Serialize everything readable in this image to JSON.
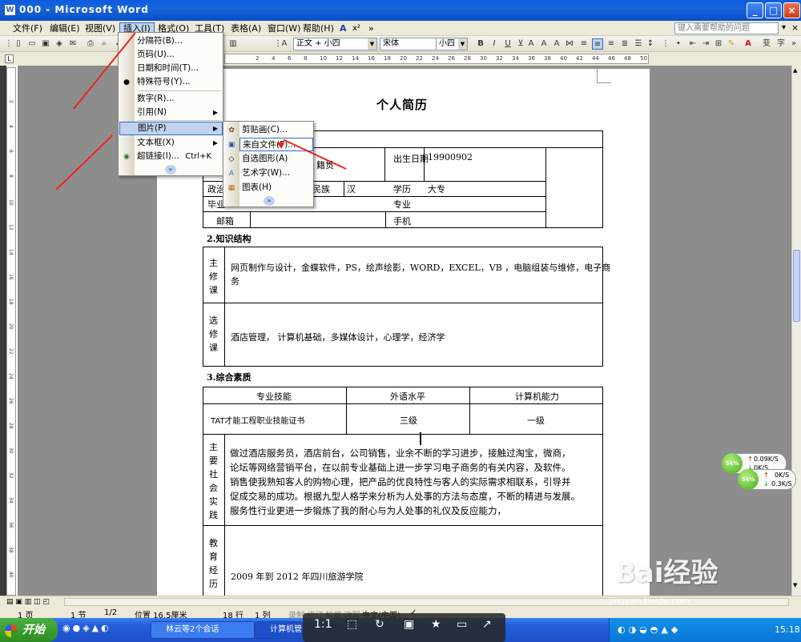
{
  "window": {
    "title": "000 - Microsoft Word"
  },
  "menubar": {
    "items": [
      "文件(F)",
      "编辑(E)",
      "视图(V)",
      "插入(I)",
      "格式(O)",
      "工具(T)",
      "表格(A)",
      "窗口(W)",
      "帮助(H)"
    ],
    "help_placeholder": "键入需要帮助的问题"
  },
  "toolbar": {
    "style": "正文 + 小四",
    "font": "宋体",
    "size": "小四"
  },
  "ruler": {
    "ticks": [
      "2",
      "4",
      "6",
      "8",
      "10",
      "12",
      "14",
      "16",
      "18",
      "20",
      "22",
      "24",
      "26",
      "28",
      "30",
      "32",
      "34",
      "36",
      "38",
      "40",
      "42",
      "44",
      "46",
      "48",
      "50"
    ],
    "vticks": [
      "2",
      "4",
      "6",
      "8",
      "10",
      "12",
      "14",
      "16",
      "18",
      "20",
      "22",
      "24",
      "26",
      "28",
      "30",
      "32",
      "34",
      "36",
      "38",
      "40"
    ]
  },
  "insert_menu": {
    "items": [
      {
        "label": "分隔符(B)...",
        "icon": "none"
      },
      {
        "label": "页码(U)...",
        "icon": "none"
      },
      {
        "label": "日期和时间(T)...",
        "icon": "none"
      },
      {
        "label": "特殊符号(Y)...",
        "icon": "bullet"
      },
      {
        "label": "数字(R)...",
        "icon": "none"
      },
      {
        "label": "引用(N)",
        "icon": "none",
        "submenu": true
      },
      {
        "label": "图片(P)",
        "icon": "none",
        "submenu": true,
        "highlighted": true
      },
      {
        "label": "文本框(X)",
        "icon": "none",
        "submenu": true
      },
      {
        "label": "超链接(I)...",
        "shortcut": "Ctrl+K",
        "icon": "globe-link"
      }
    ]
  },
  "picture_menu": {
    "items": [
      {
        "label": "剪贴画(C)...",
        "icon": "clipart"
      },
      {
        "label": "来自文件(F)...",
        "icon": "image-file"
      },
      {
        "label": "自选图形(A)",
        "icon": "autoshape"
      },
      {
        "label": "艺术字(W)...",
        "icon": "wordart"
      },
      {
        "label": "图表(H)",
        "icon": "chart"
      }
    ]
  },
  "document": {
    "title": "个人简历",
    "table1": {
      "visible": [
        "籍贯",
        "出生日期",
        "19900902",
        "政治",
        "民族",
        "汉",
        "学历",
        "大专",
        "毕业",
        "专业",
        "邮箱",
        "手机"
      ]
    },
    "section2": {
      "heading": "2.知识结构",
      "major_label": "主修课",
      "major_text_1": "网页制作与设计，金蝶软件，PS，绘声绘影，WORD，EXCEL，VB ，电脑组装与维修，电子商",
      "major_text_2": "务",
      "elective_label": "选修课",
      "elective_text": "酒店管理，  计算机基础，多媒体设计，心理学，经济学"
    },
    "section3": {
      "heading": "3.综合素质",
      "headers": [
        "专业技能",
        "外语水平",
        "计算机能力"
      ],
      "row": [
        "TAT才能工程职业技能证书",
        "三级",
        "一级"
      ],
      "practice_label": "主要社会实践",
      "practice_lines": [
        "    做过酒店服务员，酒店前台，公司销售，业余不断的学习进步，接触过淘宝，微商，",
        "论坛等网络营销平台，在以前专业基础上进一步学习电子商务的有关内容，及软件。",
        "销售使我熟知客人的购物心理，把产品的优良特性与客人的实际需求相联系，引导并",
        "促成交易的成功。根据九型人格学来分析为人处事的方法与态度，不断的精进与发展。",
        "服务性行业更进一步锻炼了我的耐心与为人处事的礼仪及反应能力，"
      ],
      "edu_label": "教育经历",
      "edu_text": "2009 年到 2012 年四川旅游学院"
    }
  },
  "statusbar": {
    "page": "1 页",
    "section": "1 节",
    "pos": "1/2",
    "at": "位置 16.5厘米",
    "line": "18 行",
    "col": "1 列",
    "modes": "录制  修订  扩展  改写",
    "lang": "中文(中国)"
  },
  "taskbar": {
    "start": "开始",
    "tasks": [
      "林云等2个会话",
      "计算机管理"
    ],
    "clock": "15:18"
  },
  "viewer": {
    "zoom": "1:1"
  },
  "net_widgets": [
    {
      "percent": "54%",
      "up": "0.09K/S",
      "down": "0K/S"
    },
    {
      "percent": "54%",
      "up": "0K/S",
      "down": "0.3K/S"
    }
  ],
  "watermark": {
    "brand": "Bai经验",
    "url": "jingyan.baidu.com"
  },
  "colors": {
    "accent": "#316ac5",
    "arrow": "#e8261e",
    "titlebar": "#0a5ce0"
  }
}
